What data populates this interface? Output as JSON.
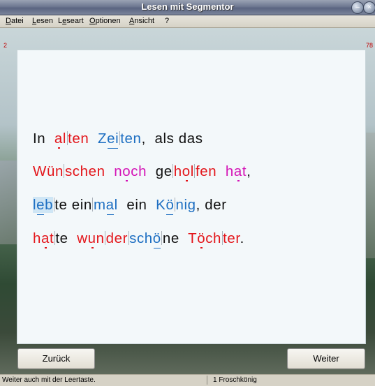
{
  "window": {
    "title": "Lesen mit Segmentor"
  },
  "menu": [
    {
      "label": "Datei",
      "accel": "D",
      "rest": "atei"
    },
    {
      "label": "Lesen",
      "accel": "L",
      "rest": "esen"
    },
    {
      "label": "Leseart",
      "accel": "e",
      "pre": "L",
      "rest": "seart"
    },
    {
      "label": "Optionen",
      "accel": "O",
      "rest": "ptionen"
    },
    {
      "label": "Ansicht",
      "accel": "A",
      "rest": "nsicht"
    },
    {
      "label": "?"
    }
  ],
  "counters": {
    "left": "2",
    "right": "78"
  },
  "text": {
    "line1": "In alten Zeiten, als das",
    "line2": "Wünschen noch geholfen hat,",
    "line3": "lebte einmal ein König, der",
    "line4": "hatte wunderschöne Töchter."
  },
  "buttons": {
    "back": "Zurück",
    "next": "Weiter"
  },
  "status": {
    "hint": "Weiter auch mit der Leertaste.",
    "story": "1 Froschkönig"
  },
  "colors": {
    "syllable_red": "#e3161b",
    "syllable_blue": "#1e6fc2",
    "syllable_magenta": "#d414b6"
  }
}
